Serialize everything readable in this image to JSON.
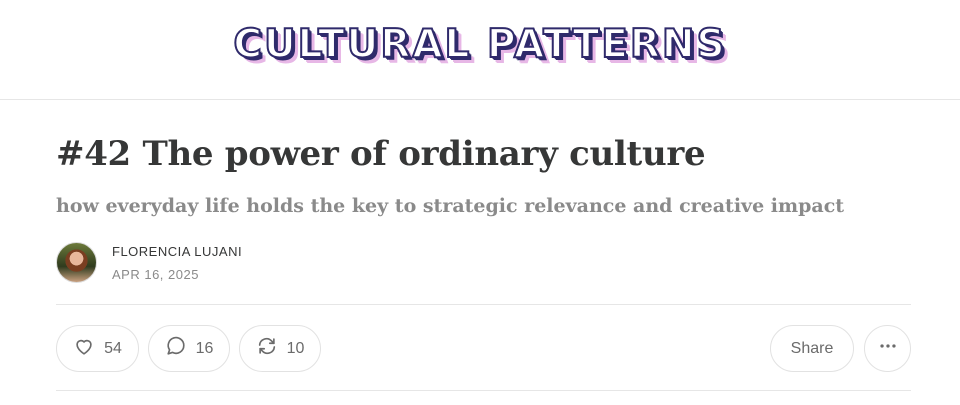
{
  "publication": {
    "name": "CULTURAL PATTERNS"
  },
  "post": {
    "title": "#42 The power of ordinary culture",
    "subtitle": "how everyday life holds the key to strategic relevance and creative impact",
    "author": "FLORENCIA LUJANI",
    "date": "APR 16, 2025"
  },
  "actions": {
    "likes": "54",
    "comments": "16",
    "restacks": "10",
    "share_label": "Share"
  },
  "icons": {
    "like": "heart-icon",
    "comment": "comment-bubble-icon",
    "restack": "restack-arrows-icon",
    "more": "ellipsis-icon"
  }
}
